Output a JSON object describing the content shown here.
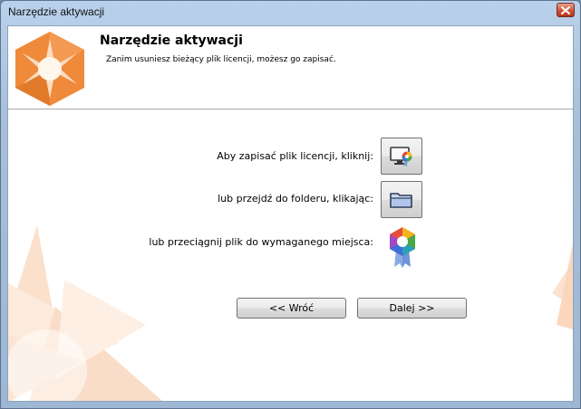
{
  "window": {
    "title": "Narzędzie aktywacji",
    "close_icon": "close-icon"
  },
  "header": {
    "title": "Narzędzie aktywacji",
    "subtitle": "Zanim usuniesz bieżący plik licencji, możesz go zapisać.",
    "logo_icon": "orange-hexagon-star-logo"
  },
  "actions": [
    {
      "label": "Aby zapisać plik licencji, kliknij:",
      "icon": "save-license-icon"
    },
    {
      "label": "lub przejdź do folderu, klikając:",
      "icon": "folder-icon"
    },
    {
      "label": "lub przeciągnij plik do wymaganego miejsca:",
      "icon": "license-badge-icon"
    }
  ],
  "nav": {
    "back_label": "<< Wróć",
    "next_label": "Dalej >>"
  },
  "colors": {
    "accent_orange": "#f08a3a",
    "window_frame": "#a6bfdb",
    "button_border": "#707070"
  }
}
